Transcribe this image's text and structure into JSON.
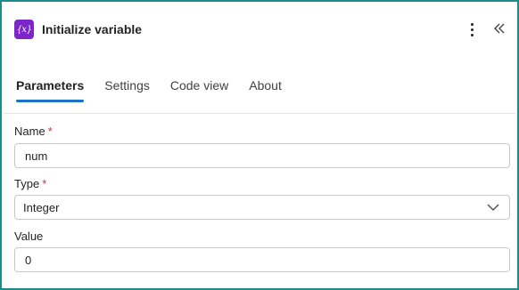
{
  "header": {
    "icon_text": "{x}",
    "title": "Initialize variable"
  },
  "tabs": [
    {
      "label": "Parameters",
      "active": true
    },
    {
      "label": "Settings",
      "active": false
    },
    {
      "label": "Code view",
      "active": false
    },
    {
      "label": "About",
      "active": false
    }
  ],
  "fields": {
    "name": {
      "label": "Name",
      "required_mark": "*",
      "value": "num"
    },
    "type": {
      "label": "Type",
      "required_mark": "*",
      "value": "Integer"
    },
    "value": {
      "label": "Value",
      "value": "0"
    }
  },
  "icons": {
    "action": "variable-icon",
    "more": "more-vertical-icon",
    "collapse": "double-chevron-left-icon",
    "dropdown": "chevron-down-icon"
  },
  "colors": {
    "accent": "#1a73c9",
    "action_icon_bg": "#7c26c9",
    "required": "#c4314b",
    "frame_border": "#1f8a8a"
  }
}
